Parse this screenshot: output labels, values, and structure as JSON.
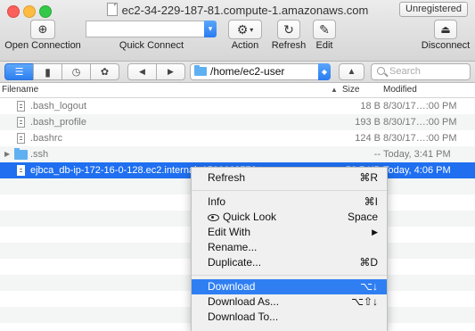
{
  "window": {
    "title": "ec2-34-229-187-81.compute-1.amazonaws.com",
    "badge": "Unregistered"
  },
  "toolbar": {
    "open_connection": "Open Connection",
    "quick_connect": "Quick Connect",
    "quick_connect_value": "",
    "action": "Action",
    "refresh": "Refresh",
    "edit": "Edit",
    "disconnect": "Disconnect"
  },
  "nav": {
    "path": "/home/ec2-user",
    "search_placeholder": "Search"
  },
  "columns": {
    "filename": "Filename",
    "size": "Size",
    "modified": "Modified",
    "sort_indicator": "▲"
  },
  "files": [
    {
      "name": ".bash_logout",
      "size": "18 B",
      "modified": "8/30/17…:00 PM",
      "type": "file"
    },
    {
      "name": ".bash_profile",
      "size": "193 B",
      "modified": "8/30/17…:00 PM",
      "type": "file"
    },
    {
      "name": ".bashrc",
      "size": "124 B",
      "modified": "8/30/17…:00 PM",
      "type": "file"
    },
    {
      "name": ".ssh",
      "size": "--",
      "modified": "Today, 3:41 PM",
      "type": "folder"
    },
    {
      "name": "ejbca_db-ip-172-16-0-128.ec2.internal_1500663778.tar.gz",
      "size": "52.7 KB",
      "modified": "Today, 4:06 PM",
      "type": "file",
      "selected": true
    }
  ],
  "context_menu": {
    "refresh": {
      "label": "Refresh",
      "shortcut": "⌘R"
    },
    "info": {
      "label": "Info",
      "shortcut": "⌘I"
    },
    "quick_look": {
      "label": "Quick Look",
      "shortcut": "Space"
    },
    "edit_with": {
      "label": "Edit With",
      "shortcut": "▶"
    },
    "rename": {
      "label": "Rename..."
    },
    "duplicate": {
      "label": "Duplicate...",
      "shortcut": "⌘D"
    },
    "download": {
      "label": "Download",
      "shortcut": "⌥↓"
    },
    "download_as": {
      "label": "Download As...",
      "shortcut": "⌥⇧↓"
    },
    "download_to": {
      "label": "Download To..."
    }
  }
}
